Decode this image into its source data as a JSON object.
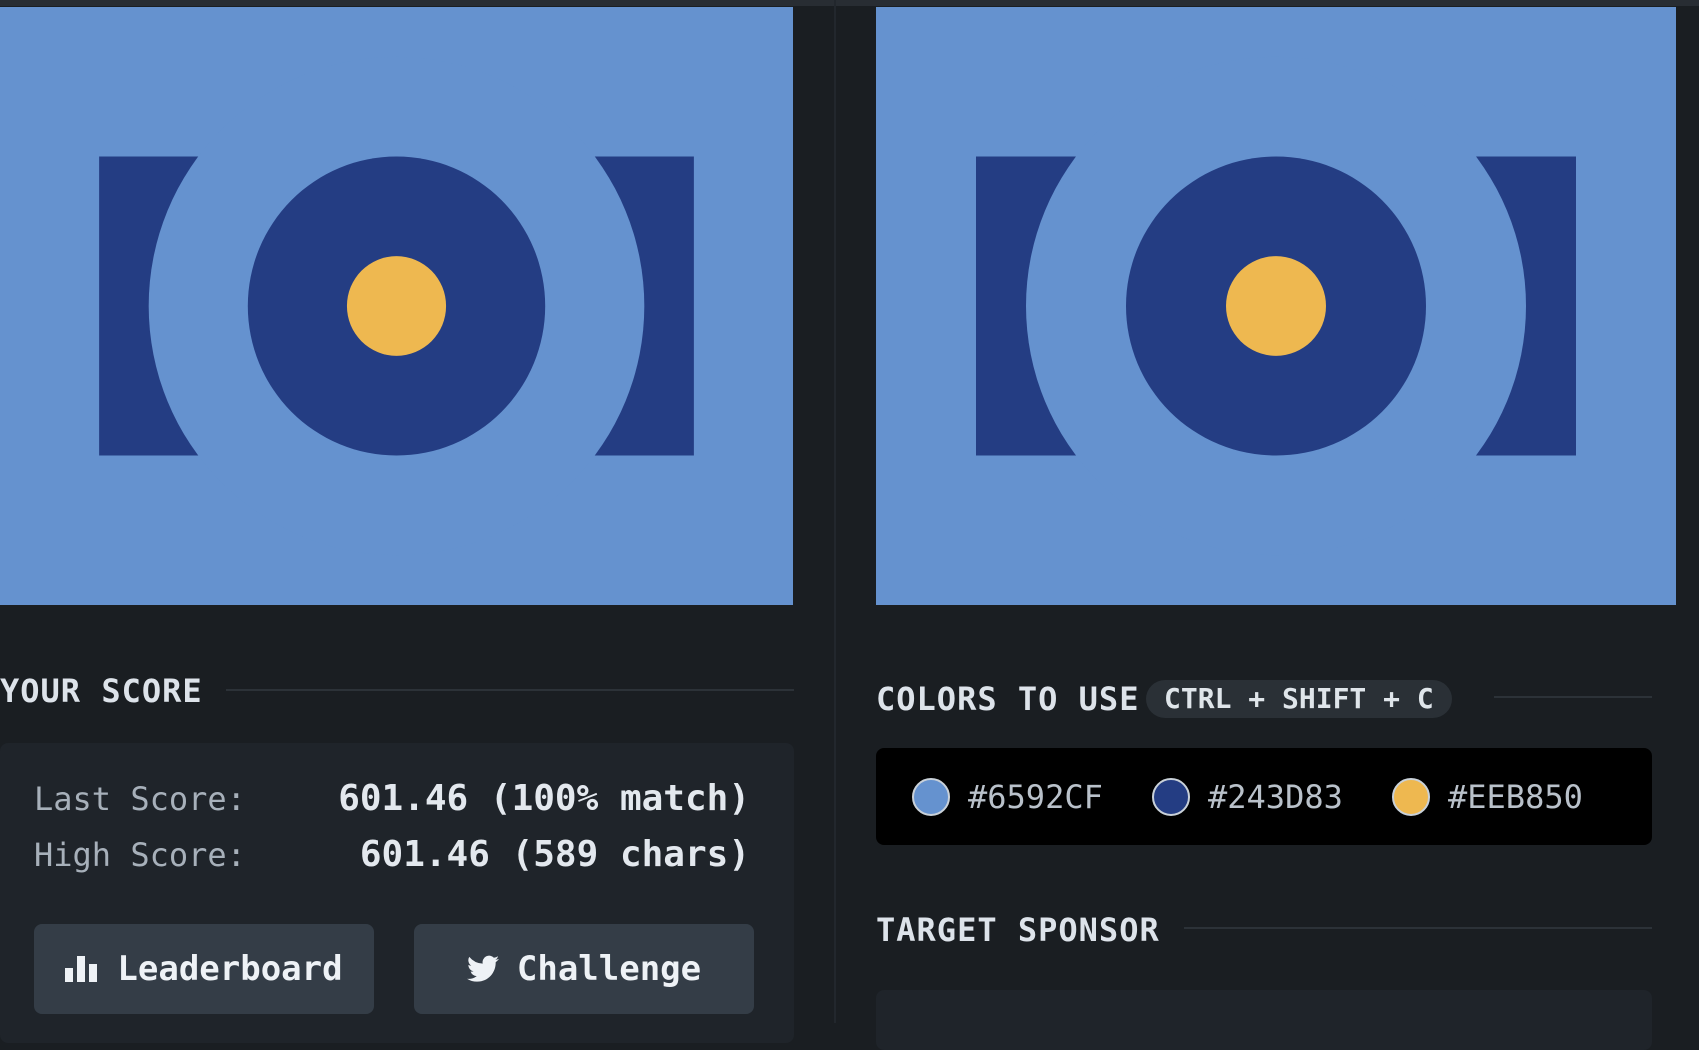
{
  "colors": {
    "background": "#6592CF",
    "dark": "#243D83",
    "accent": "#EEB850"
  },
  "your_score": {
    "title": "YOUR SCORE",
    "last_score_label": "Last Score:",
    "last_score_value": "601.46 (100% match)",
    "high_score_label": "High Score:",
    "high_score_value": "601.46 (589 chars)",
    "leaderboard_label": "Leaderboard",
    "leaderboard_icon": "bar-chart-icon",
    "challenge_label": "Challenge",
    "challenge_icon": "twitter-icon"
  },
  "colors_panel": {
    "title": "COLORS TO USE",
    "shortcut": "CTRL + SHIFT + C",
    "items": [
      {
        "hex": "#6592CF",
        "color": "#6592CF"
      },
      {
        "hex": "#243D83",
        "color": "#243D83"
      },
      {
        "hex": "#EEB850",
        "color": "#EEB850"
      }
    ]
  },
  "sponsor": {
    "title": "TARGET SPONSOR"
  }
}
